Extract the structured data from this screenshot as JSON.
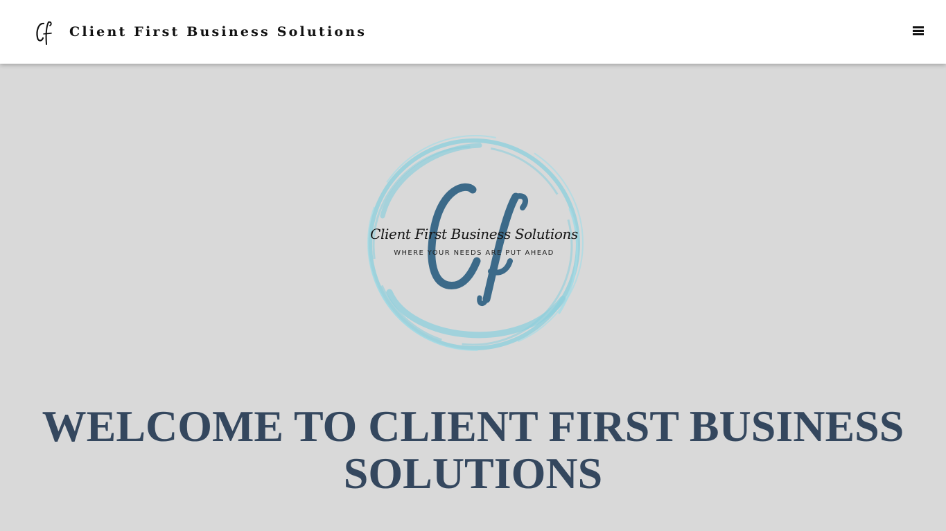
{
  "header": {
    "brand_mark_text": "Cf",
    "brand_name": "Client First Business Solutions",
    "menu_icon": "hamburger-menu-icon"
  },
  "hero": {
    "logo": {
      "monogram": "Cf",
      "title": "Client First Business Solutions",
      "tagline": "WHERE YOUR NEEDS ARE PUT AHEAD",
      "ring_color": "#8ecfdc",
      "monogram_color": "#3c6a89"
    },
    "heading": "WELCOME TO CLIENT FIRST BUSINESS SOLUTIONS"
  },
  "colors": {
    "header_bg": "#ffffff",
    "page_bg": "#d9d9d9",
    "heading": "#34475e"
  }
}
